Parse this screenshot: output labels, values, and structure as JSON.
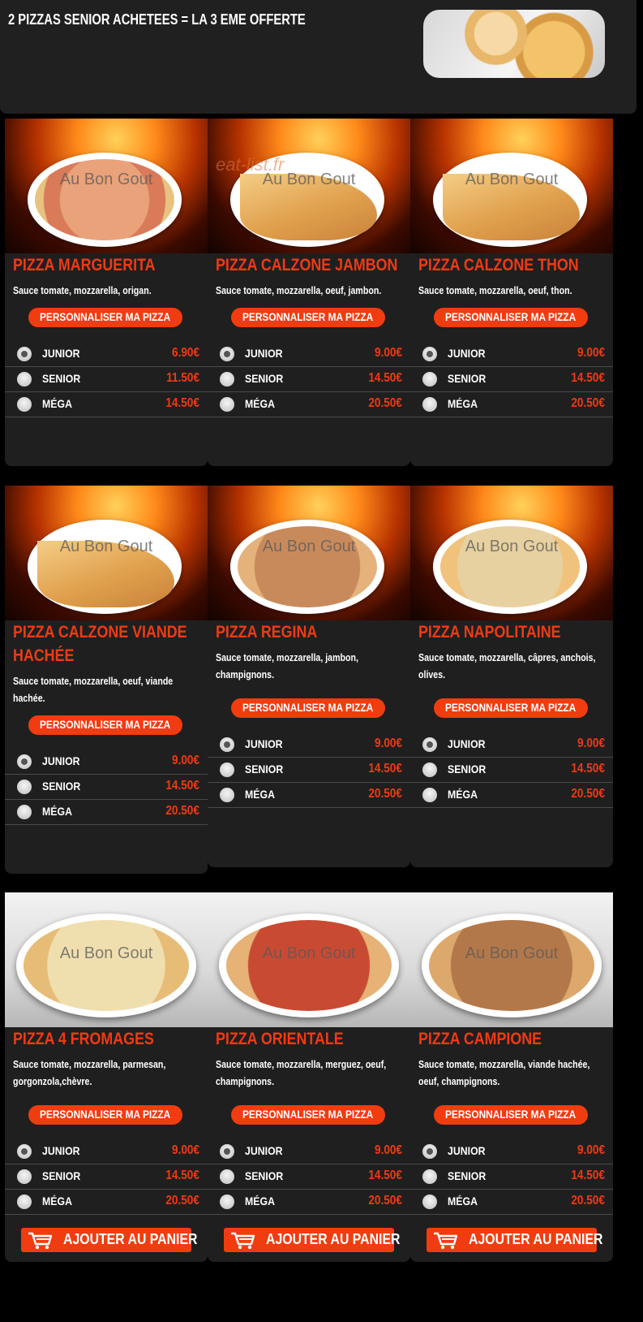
{
  "banner": {
    "text": "2 PIZZAS SENIOR ACHETEES = LA 3 EME OFFERTE"
  },
  "common": {
    "customize_label": "PERSONNALISER MA PIZZA",
    "cart_label": "AJOUTER AU PANIER",
    "watermark": "Au Bon Gout",
    "watermark2": "eat-list.fr"
  },
  "pizzas": [
    {
      "name": "PIZZA MARGUERITA",
      "description": "Sauce tomate, mozzarella, origan.",
      "sizes": [
        {
          "name": "JUNIOR",
          "price": "6.90€"
        },
        {
          "name": "SENIOR",
          "price": "11.50€"
        },
        {
          "name": "MÉGA",
          "price": "14.50€"
        }
      ]
    },
    {
      "name": "PIZZA CALZONE JAMBON",
      "description": "Sauce tomate, mozzarella, oeuf, jambon.",
      "sizes": [
        {
          "name": "JUNIOR",
          "price": "9.00€"
        },
        {
          "name": "SENIOR",
          "price": "14.50€"
        },
        {
          "name": "MÉGA",
          "price": "20.50€"
        }
      ]
    },
    {
      "name": "PIZZA CALZONE THON",
      "description": "Sauce tomate, mozzarella, oeuf, thon.",
      "sizes": [
        {
          "name": "JUNIOR",
          "price": "9.00€"
        },
        {
          "name": "SENIOR",
          "price": "14.50€"
        },
        {
          "name": "MÉGA",
          "price": "20.50€"
        }
      ]
    },
    {
      "name": "PIZZA CALZONE VIANDE HACHÉE",
      "description": "Sauce tomate, mozzarella, oeuf, viande hachée.",
      "sizes": [
        {
          "name": "JUNIOR",
          "price": "9.00€"
        },
        {
          "name": "SENIOR",
          "price": "14.50€"
        },
        {
          "name": "MÉGA",
          "price": "20.50€"
        }
      ]
    },
    {
      "name": "PIZZA REGINA",
      "description": "Sauce tomate, mozzarella, jambon, champignons.",
      "sizes": [
        {
          "name": "JUNIOR",
          "price": "9.00€"
        },
        {
          "name": "SENIOR",
          "price": "14.50€"
        },
        {
          "name": "MÉGA",
          "price": "20.50€"
        }
      ]
    },
    {
      "name": "PIZZA NAPOLITAINE",
      "description": "Sauce tomate, mozzarella, câpres, anchois, olives.",
      "sizes": [
        {
          "name": "JUNIOR",
          "price": "9.00€"
        },
        {
          "name": "SENIOR",
          "price": "14.50€"
        },
        {
          "name": "MÉGA",
          "price": "20.50€"
        }
      ]
    },
    {
      "name": "PIZZA 4 FROMAGES",
      "description": "Sauce tomate, mozzarella, parmesan, gorgonzola,chèvre.",
      "sizes": [
        {
          "name": "JUNIOR",
          "price": "9.00€"
        },
        {
          "name": "SENIOR",
          "price": "14.50€"
        },
        {
          "name": "MÉGA",
          "price": "20.50€"
        }
      ]
    },
    {
      "name": "PIZZA ORIENTALE",
      "description": "Sauce tomate, mozzarella, merguez, oeuf, champignons.",
      "sizes": [
        {
          "name": "JUNIOR",
          "price": "9.00€"
        },
        {
          "name": "SENIOR",
          "price": "14.50€"
        },
        {
          "name": "MÉGA",
          "price": "20.50€"
        }
      ]
    },
    {
      "name": "PIZZA CAMPIONE",
      "description": "Sauce tomate, mozzarella, viande hachée, oeuf, champignons.",
      "sizes": [
        {
          "name": "JUNIOR",
          "price": "9.00€"
        },
        {
          "name": "SENIOR",
          "price": "14.50€"
        },
        {
          "name": "MÉGA",
          "price": "20.50€"
        }
      ]
    }
  ],
  "colors": {
    "accent": "#f13c0f",
    "price": "#f03a12",
    "card": "#1f1f1f",
    "background": "#000000"
  }
}
